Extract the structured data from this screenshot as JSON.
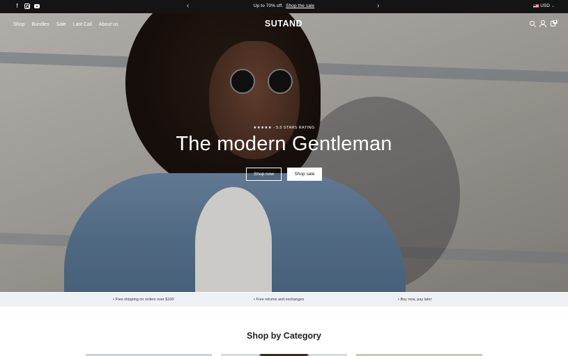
{
  "announcement": {
    "promo_text": "Up to 70% off.",
    "promo_link": "Shop the sale",
    "prev_arrow": "‹",
    "next_arrow": "›",
    "currency": "USD",
    "social_icons": [
      "facebook-icon",
      "instagram-icon",
      "youtube-icon"
    ]
  },
  "header": {
    "logo": "SUTAND",
    "nav": [
      "Shop",
      "Bundles",
      "Sale",
      "Last Call",
      "About us"
    ],
    "cart_count": "1",
    "icons": [
      "search-icon",
      "account-icon",
      "cart-icon"
    ]
  },
  "hero": {
    "rating": "★★★★★ - 5.0 STARS RATING",
    "headline": "The modern Gentleman",
    "primary_button": "Shop now",
    "secondary_button": "Shop sale"
  },
  "features": [
    "• Free shipping on orders over $100",
    "• Free returns and exchanges",
    "• Buy now, pay later"
  ],
  "categories": {
    "title": "Shop by Category"
  },
  "colors": {
    "topbar_bg": "#141414",
    "features_bg": "#eef1f4",
    "text_dark": "#111111"
  }
}
